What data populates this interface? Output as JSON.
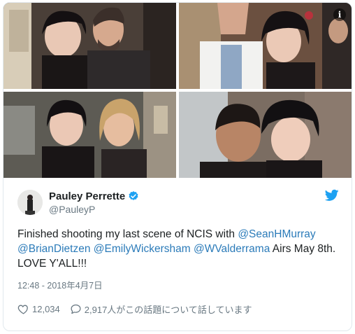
{
  "photos": {
    "info_label": "i",
    "items": [
      {
        "name": "photo-1"
      },
      {
        "name": "photo-2"
      },
      {
        "name": "photo-3"
      },
      {
        "name": "photo-4"
      }
    ]
  },
  "tweet": {
    "display_name": "Pauley Perrette",
    "handle": "@PauleyP",
    "text_parts": {
      "p1": "Finished shooting my last scene of NCIS with ",
      "m1": "@SeanHMurray",
      "m2": "@BrianDietzen",
      "m3": "@EmilyWickersham",
      "m4": "@WValderrama",
      "p2": " Airs May 8th.",
      "p3": "LOVE Y'ALL!!!"
    },
    "timestamp": "12:48 - 2018年4月7日",
    "likes": "12,034",
    "replies_text": "2,917人がこの話題について話しています"
  },
  "icons": {
    "verified": "verified-badge-icon",
    "bird": "twitter-bird-icon",
    "heart": "heart-icon",
    "reply": "reply-bubble-icon",
    "info": "info-icon"
  },
  "colors": {
    "link": "#2b7bb9",
    "twitter_blue": "#1da1f2",
    "muted": "#697882",
    "border": "#e1e8ed"
  }
}
